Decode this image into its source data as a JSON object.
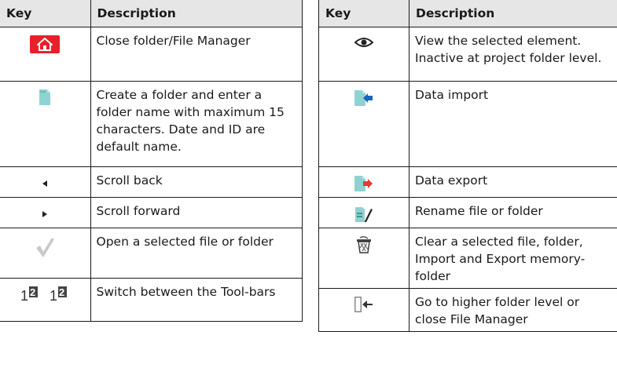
{
  "left_table": {
    "header_key": "Key",
    "header_description": "Description",
    "rows": [
      {
        "icon": "home-icon",
        "description": "Close folder/File Manager"
      },
      {
        "icon": "new-folder-icon",
        "description": "Create a folder and enter a folder name with maximum 15 characters. Date and ID are default name."
      },
      {
        "icon": "triangle-left-icon",
        "description": "Scroll back"
      },
      {
        "icon": "triangle-right-icon",
        "description": "Scroll forward"
      },
      {
        "icon": "checkmark-icon",
        "description": "Open a selected file or folder"
      },
      {
        "icon": "toolbar-switch-icon",
        "icon_text": "12",
        "description": "Switch between the Tool-bars"
      }
    ]
  },
  "right_table": {
    "header_key": "Key",
    "header_description": "Description",
    "rows": [
      {
        "icon": "eye-icon",
        "description": "View the selected element. Inactive at project folder level."
      },
      {
        "icon": "data-import-icon",
        "description": "Data import"
      },
      {
        "icon": "data-export-icon",
        "description": "Data export"
      },
      {
        "icon": "rename-icon",
        "description": "Rename file or folder"
      },
      {
        "icon": "trash-icon",
        "description": "Clear a selected file, folder, Import and Export memory-folder"
      },
      {
        "icon": "exit-door-icon",
        "description": "Go to higher folder level or close File Manager"
      }
    ]
  },
  "colors": {
    "home_red": "#e8202a",
    "file_teal": "#8fd3d1",
    "arrow_blue": "#1565c0",
    "arrow_red": "#e53935",
    "header_gray": "#e6e6e6"
  }
}
